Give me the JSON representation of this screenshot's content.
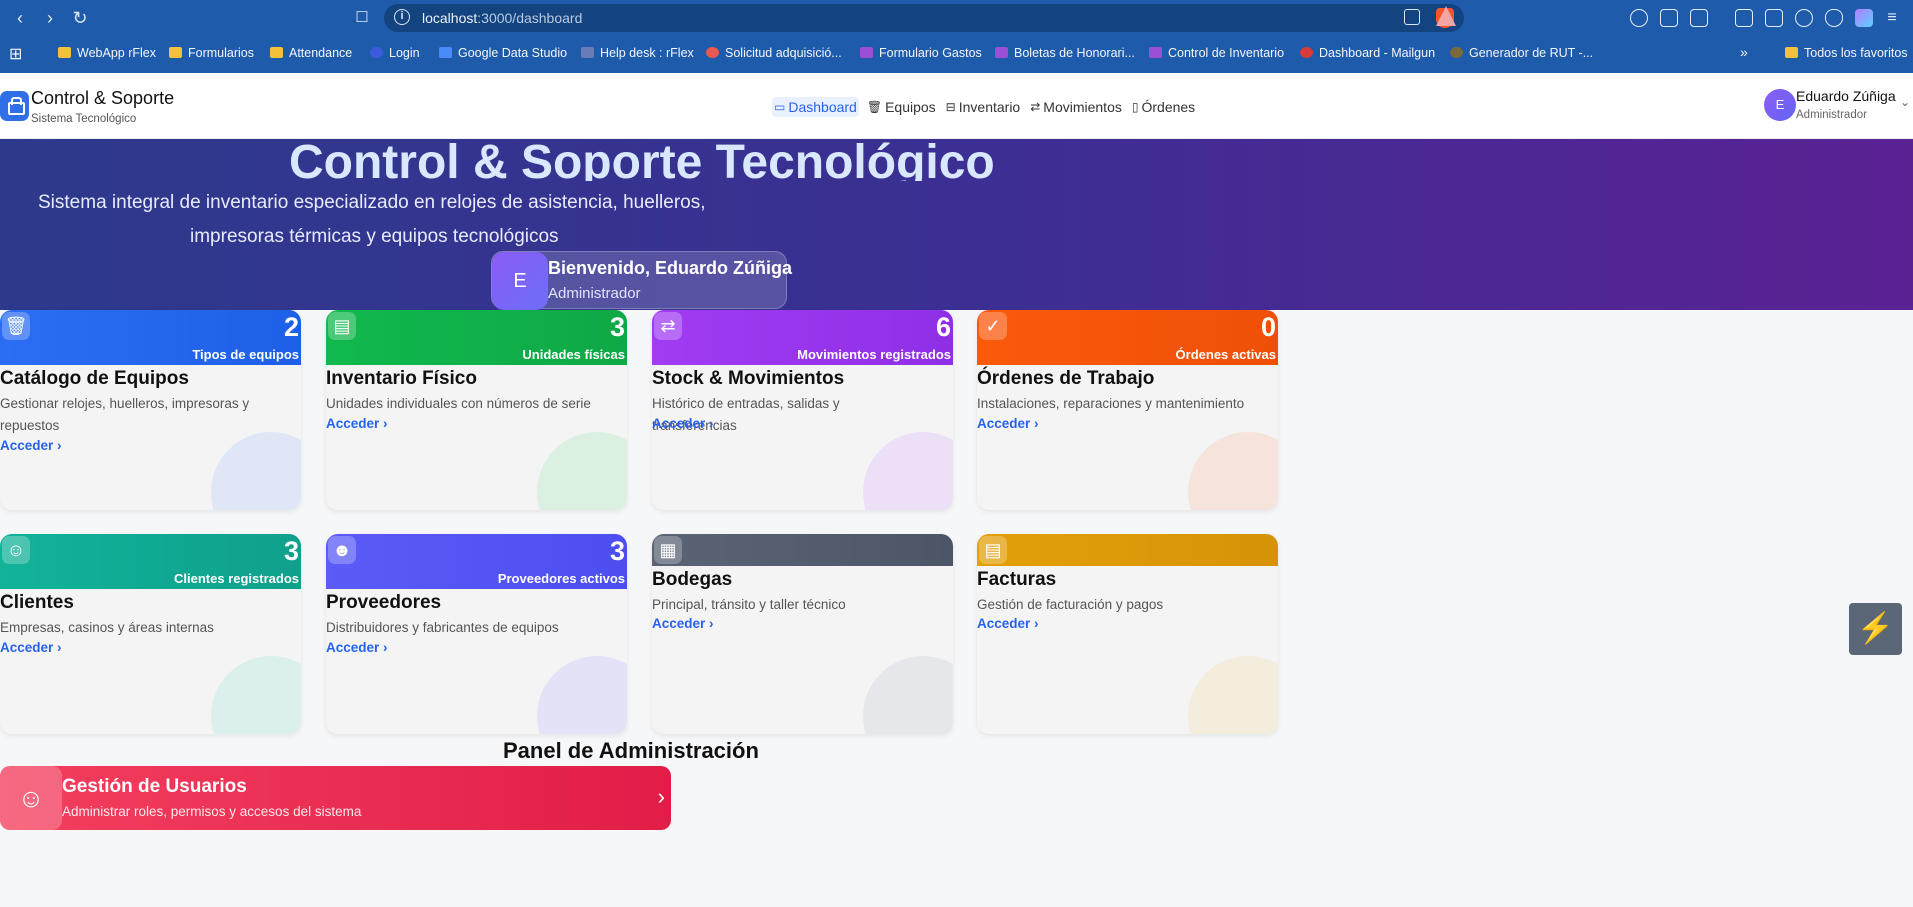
{
  "browser": {
    "url_host": "localhost",
    "url_rest": ":3000/dashboard",
    "bookmarks": [
      {
        "label": "WebApp rFlex",
        "kind": "folder"
      },
      {
        "label": "Formularios",
        "kind": "folder"
      },
      {
        "label": "Attendance",
        "kind": "folder"
      },
      {
        "label": "Login",
        "kind": "site"
      },
      {
        "label": "Google Data Studio",
        "kind": "site"
      },
      {
        "label": "Help desk : rFlex",
        "kind": "site"
      },
      {
        "label": "Solicitud adquisició...",
        "kind": "site"
      },
      {
        "label": "Formulario Gastos",
        "kind": "site"
      },
      {
        "label": "Boletas de Honorari...",
        "kind": "site"
      },
      {
        "label": "Control de Inventario",
        "kind": "site"
      },
      {
        "label": "Dashboard - Mailgun",
        "kind": "site"
      },
      {
        "label": "Generador de RUT -...",
        "kind": "site"
      }
    ],
    "more_bookmarks": "»",
    "all_favorites": "Todos los favoritos"
  },
  "app": {
    "title": "Control & Soporte",
    "subtitle": "Sistema Tecnológico",
    "nav": [
      {
        "label": "Dashboard",
        "icon": "dashboard-icon",
        "glyph": "▭"
      },
      {
        "label": "Equipos",
        "icon": "trash-icon",
        "glyph": "🗑"
      },
      {
        "label": "Inventario",
        "icon": "box-icon",
        "glyph": "⊟"
      },
      {
        "label": "Movimientos",
        "icon": "arrows-icon",
        "glyph": "⇄"
      },
      {
        "label": "Órdenes",
        "icon": "clipboard-icon",
        "glyph": "▯"
      }
    ],
    "user": {
      "initial": "E",
      "name": "Eduardo Zúñiga",
      "role": "Administrador"
    }
  },
  "hero": {
    "title": "Control & Soporte Tecnológico",
    "desc_line1": "Sistema integral de inventario especializado en relojes de asistencia, huelleros,",
    "desc_line2": "impresoras térmicas y equipos tecnológicos",
    "welcome_initial": "E",
    "welcome_title": "Bienvenido, Eduardo Zúñiga",
    "welcome_role": "Administrador"
  },
  "cards": [
    {
      "title": "Catálogo de Equipos",
      "desc": "Gestionar relojes, huelleros, impresoras y repuestos",
      "count": "2",
      "count_label": "Tipos de equipos",
      "link": "Acceder ›",
      "color": "#2b6ef5",
      "color2": "#1e5fe8",
      "deco": "#dfe7f7",
      "icon": "trash-icon",
      "glyph": "🗑"
    },
    {
      "title": "Inventario Físico",
      "desc": "Unidades individuales con números de serie",
      "count": "3",
      "count_label": "Unidades físicas",
      "link": "Acceder ›",
      "color": "#11b94e",
      "color2": "#0fa846",
      "deco": "#dcf0e2",
      "icon": "box-icon",
      "glyph": "▤"
    },
    {
      "title": "Stock & Movimientos",
      "desc": "Histórico de entradas, salidas y transferencias",
      "count": "6",
      "count_label": "Movimientos registrados",
      "link": "Acceder ›",
      "color": "#a13cf3",
      "color2": "#8f2fe6",
      "deco": "#ebe0f5",
      "icon": "arrows-icon",
      "glyph": "⇄"
    },
    {
      "title": "Órdenes de Trabajo",
      "desc": "Instalaciones, reparaciones y mantenimiento",
      "count": "0",
      "count_label": "Órdenes activas",
      "link": "Acceder ›",
      "color": "#fb5a0c",
      "color2": "#ef4f08",
      "deco": "#f5e3dc",
      "icon": "clipboard-icon",
      "glyph": "✓"
    },
    {
      "title": "Clientes",
      "desc": "Empresas, casinos y áreas internas",
      "count": "3",
      "count_label": "Clientes registrados",
      "link": "Acceder ›",
      "color": "#12b39a",
      "color2": "#0fa08b",
      "deco": "#dbefec",
      "icon": "user-icon",
      "glyph": "☺"
    },
    {
      "title": "Proveedores",
      "desc": "Distribuidores y fabricantes de equipos",
      "count": "3",
      "count_label": "Proveedores activos",
      "link": "Acceder ›",
      "color": "#5b5bf7",
      "color2": "#4c4ef0",
      "deco": "#e4e2f6",
      "icon": "users-icon",
      "glyph": "☻"
    },
    {
      "title": "Bodegas",
      "desc": "Principal, tránsito y taller técnico",
      "count": "",
      "count_label": "",
      "link": "Acceder ›",
      "color": "#5a6475",
      "color2": "#4d5666",
      "deco": "#e6e7ea",
      "icon": "building-icon",
      "glyph": "▦"
    },
    {
      "title": "Facturas",
      "desc": "Gestión de facturación y pagos",
      "count": "",
      "count_label": "",
      "link": "Acceder ›",
      "color": "#e3a00a",
      "color2": "#d69308",
      "deco": "#f4ecdd",
      "icon": "document-icon",
      "glyph": "▤"
    }
  ],
  "admin": {
    "section_title": "Panel de Administración",
    "title": "Gestión de Usuarios",
    "desc": "Administrar roles, permisos y accesos del sistema",
    "icon": "user-gear-icon",
    "glyph": "☺",
    "chevron": "›"
  },
  "fab_glyph": "⚡"
}
